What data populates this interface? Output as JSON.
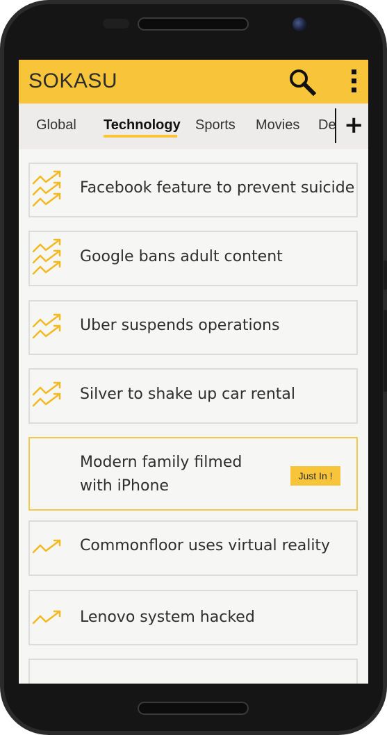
{
  "app": {
    "title": "SOKASU"
  },
  "toolbar": {
    "search_icon": "search-icon",
    "menu_icon": "more-vert-icon"
  },
  "tabs": [
    {
      "label": "Global",
      "active": false
    },
    {
      "label": "Technology",
      "active": true
    },
    {
      "label": "Sports",
      "active": false
    },
    {
      "label": "Movies",
      "active": false
    },
    {
      "label": "De",
      "active": false
    }
  ],
  "add_tab": {
    "label": "+"
  },
  "accent_color": "#f7c43a",
  "news": [
    {
      "title": "Facebook feature to prevent suicide",
      "trend": "three-arrow-trend-icon"
    },
    {
      "title": "Google bans adult content",
      "trend": "three-arrow-trend-icon"
    },
    {
      "title": "Uber suspends operations",
      "trend": "two-arrow-trend-icon"
    },
    {
      "title": "Silver to shake up car rental",
      "trend": "two-arrow-trend-icon"
    },
    {
      "title": "Modern family filmed with iPhone",
      "badge": "Just In !"
    },
    {
      "title": "Commonfloor uses virtual reality",
      "trend": "one-arrow-trend-icon"
    },
    {
      "title": "Lenovo system hacked",
      "trend": "one-arrow-trend-icon"
    }
  ]
}
